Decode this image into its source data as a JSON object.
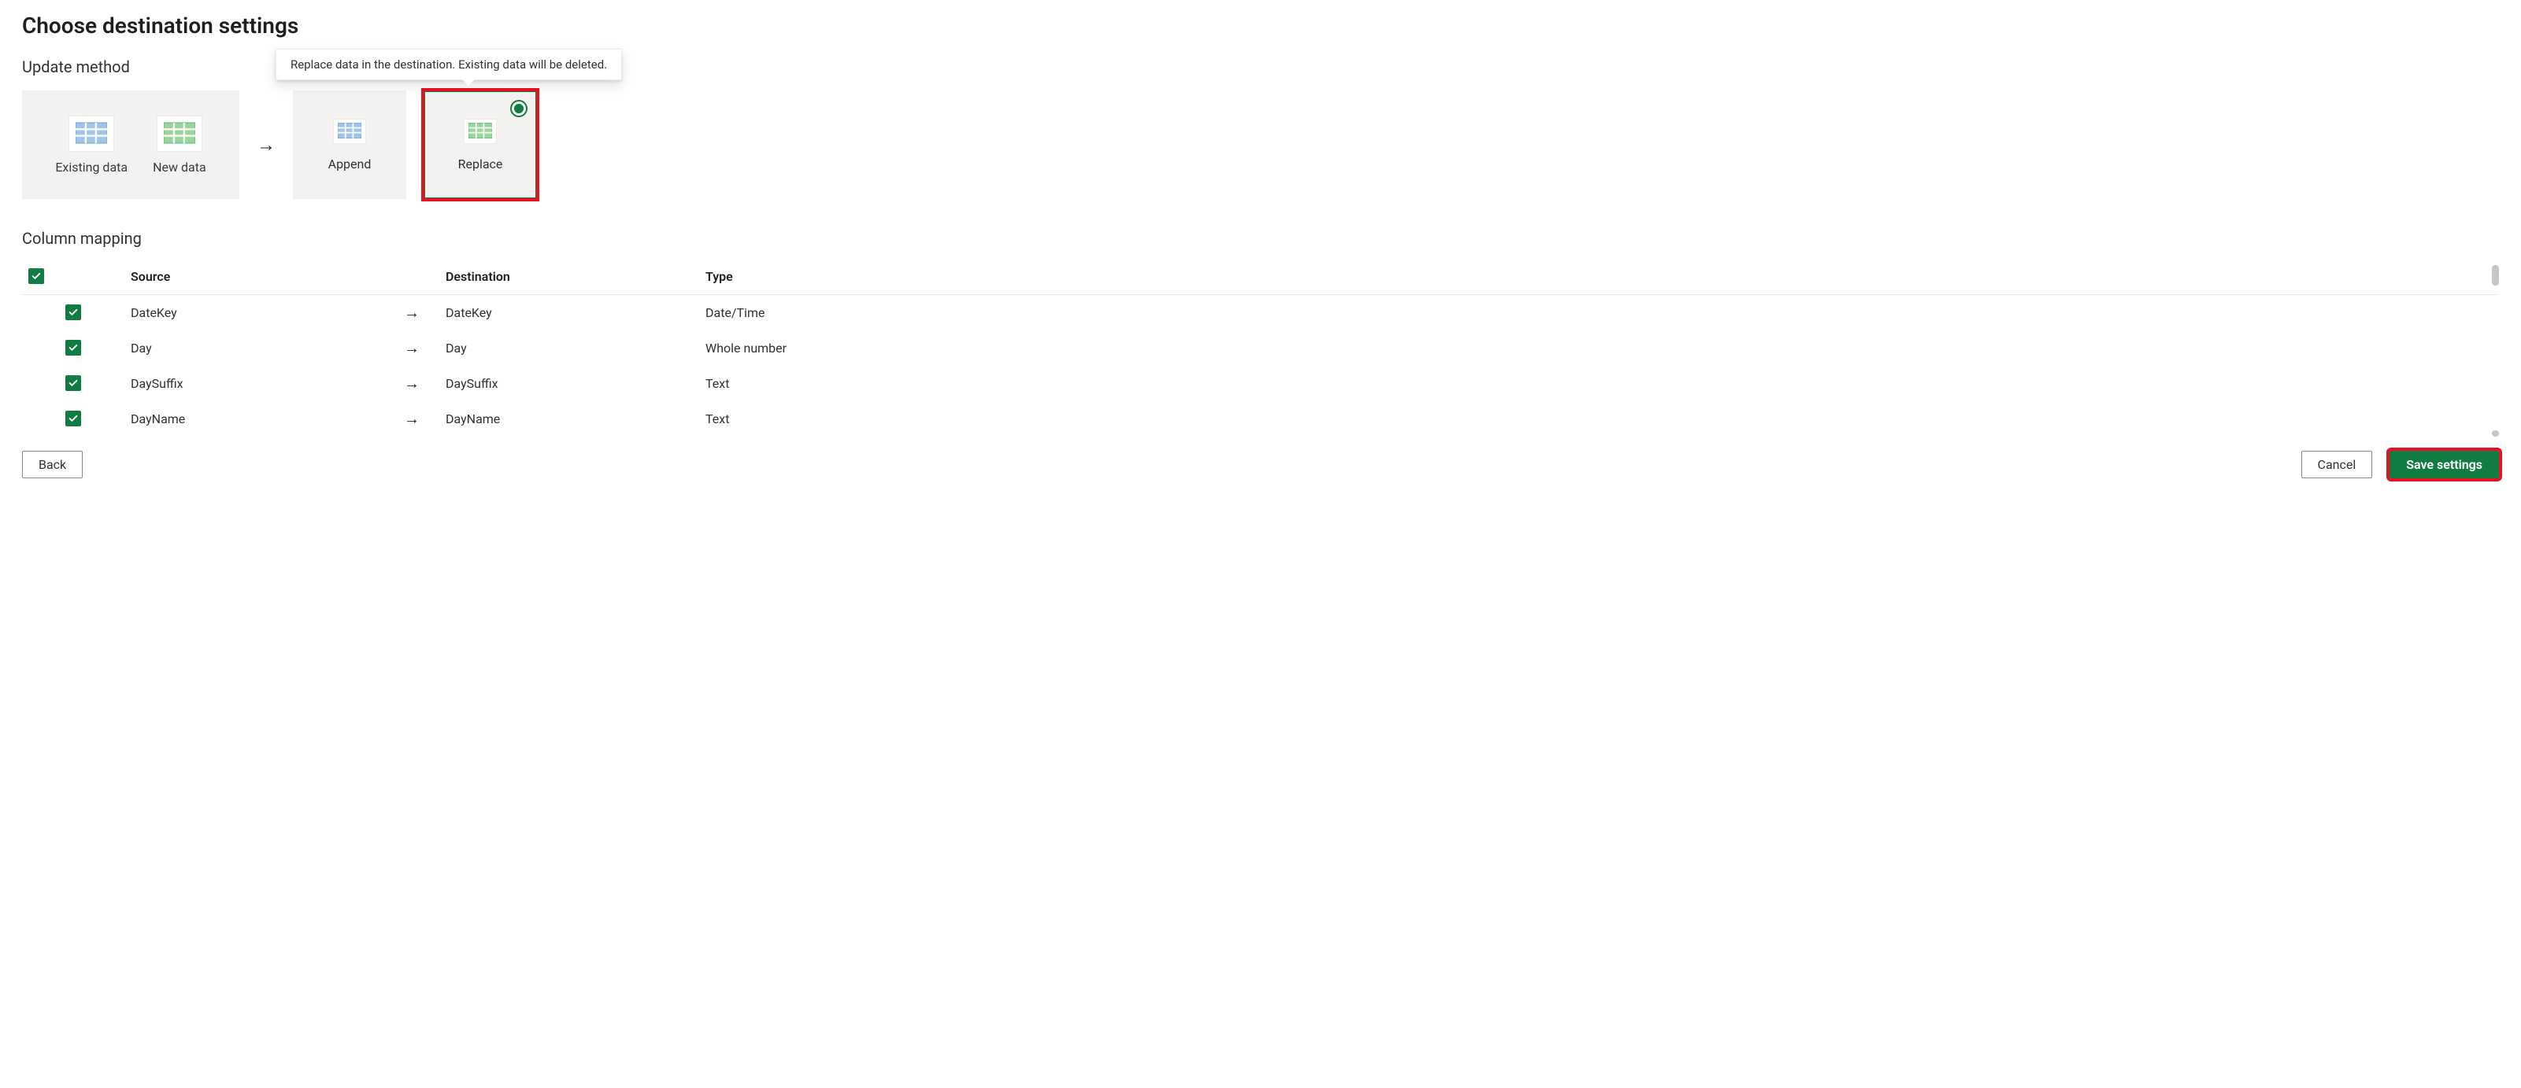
{
  "title": "Choose destination settings",
  "tooltip": "Replace data in the destination. Existing data will be deleted.",
  "update_method": {
    "section_label": "Update method",
    "existing_label": "Existing data",
    "new_label": "New data",
    "append_label": "Append",
    "replace_label": "Replace",
    "selected": "Replace"
  },
  "column_mapping": {
    "section_label": "Column mapping",
    "headers": {
      "source": "Source",
      "destination": "Destination",
      "type": "Type"
    },
    "rows": [
      {
        "checked": true,
        "source": "DateKey",
        "destination": "DateKey",
        "type": "Date/Time"
      },
      {
        "checked": true,
        "source": "Day",
        "destination": "Day",
        "type": "Whole number"
      },
      {
        "checked": true,
        "source": "DaySuffix",
        "destination": "DaySuffix",
        "type": "Text"
      },
      {
        "checked": true,
        "source": "DayName",
        "destination": "DayName",
        "type": "Text"
      }
    ]
  },
  "footer": {
    "back": "Back",
    "cancel": "Cancel",
    "save": "Save settings"
  },
  "colors": {
    "accent_green": "#107c41",
    "highlight_red": "#e81123",
    "panel_gray": "#f3f2f1"
  }
}
